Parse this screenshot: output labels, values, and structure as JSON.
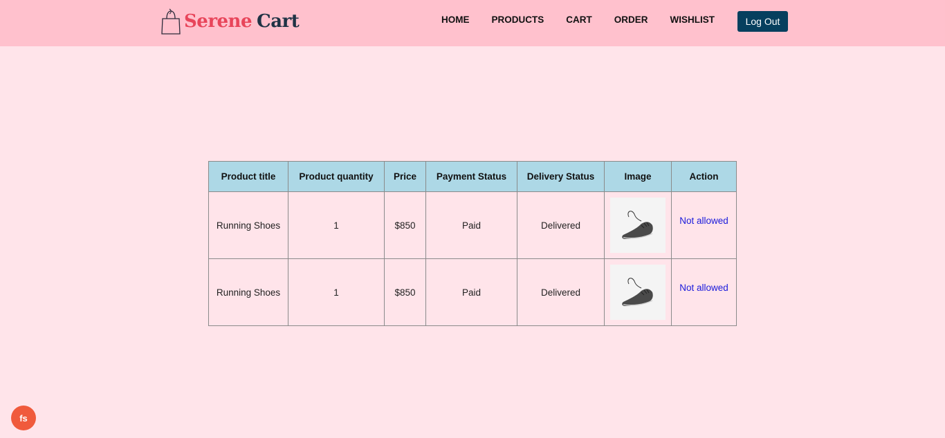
{
  "brand": {
    "name_part1": "Serene",
    "name_part2": "Cart",
    "logo_icon": "shopping-bag-icon"
  },
  "nav": {
    "items": [
      {
        "label": "HOME"
      },
      {
        "label": "PRODUCTS"
      },
      {
        "label": "CART"
      },
      {
        "label": "ORDER"
      },
      {
        "label": "WISHLIST"
      }
    ],
    "logout_label": "Log Out"
  },
  "orders": {
    "headers": [
      "Product title",
      "Product quantity",
      "Price",
      "Payment Status",
      "Delivery Status",
      "Image",
      "Action"
    ],
    "rows": [
      {
        "title": "Running Shoes",
        "quantity": "1",
        "price": "$850",
        "payment_status": "Paid",
        "delivery_status": "Delivered",
        "image": "running-shoe-image",
        "action": "Not allowed"
      },
      {
        "title": "Running Shoes",
        "quantity": "1",
        "price": "$850",
        "payment_status": "Paid",
        "delivery_status": "Delivered",
        "image": "running-shoe-image",
        "action": "Not allowed"
      }
    ]
  },
  "badge": {
    "label": "fs"
  },
  "colors": {
    "header_bg": "#ffc1cd",
    "page_bg": "#ffe4ea",
    "table_header_bg": "#add8e6",
    "logout_bg": "#063f5e",
    "brand_red": "#e8455a",
    "brand_dark": "#1f3345",
    "link": "#1a1adb",
    "badge_bg": "#f05a3c"
  }
}
